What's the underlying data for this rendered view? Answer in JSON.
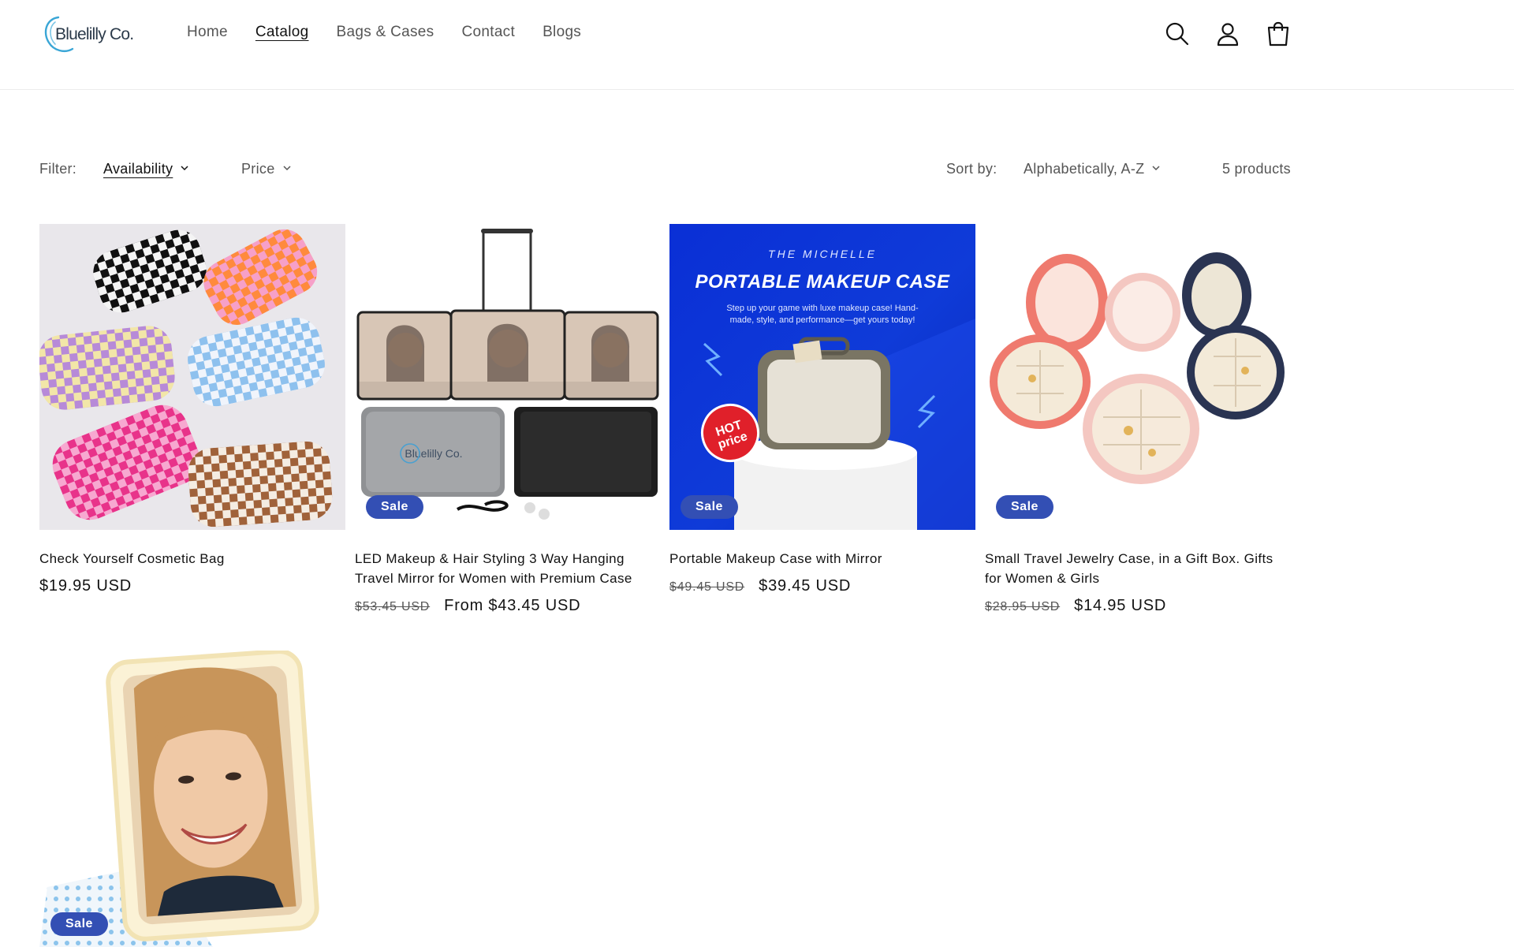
{
  "brand": {
    "name": "Bluelilly Co."
  },
  "nav": {
    "items": [
      {
        "label": "Home",
        "active": false
      },
      {
        "label": "Catalog",
        "active": true
      },
      {
        "label": "Bags & Cases",
        "active": false
      },
      {
        "label": "Contact",
        "active": false
      },
      {
        "label": "Blogs",
        "active": false
      }
    ]
  },
  "header_icons": [
    "search-icon",
    "account-icon",
    "cart-icon"
  ],
  "filters": {
    "label": "Filter:",
    "availability": "Availability",
    "price": "Price",
    "sort_label": "Sort by:",
    "sort_value": "Alphabetically, A-Z",
    "count": "5 products"
  },
  "products": [
    {
      "title": "Check Yourself Cosmetic Bag",
      "price": "$19.95 USD",
      "compare_at": "",
      "badge": ""
    },
    {
      "title": "LED Makeup & Hair Styling 3 Way Hanging Travel Mirror for Women with Premium Case",
      "price": "From $43.45 USD",
      "compare_at": "$53.45 USD",
      "badge": "Sale",
      "image_text": "Bluelilly Co."
    },
    {
      "title": "Portable Makeup Case with Mirror",
      "price": "$39.45 USD",
      "compare_at": "$49.45 USD",
      "badge": "Sale",
      "image_text": {
        "kicker": "THE MICHELLE",
        "headline": "PORTABLE MAKEUP CASE",
        "desc": "Step up your game with luxe makeup case! Hand-made, style, and performance—get yours today!",
        "sticker": "HOT price"
      }
    },
    {
      "title": "Small Travel Jewelry Case, in a Gift Box. Gifts for Women & Girls",
      "price": "$14.95 USD",
      "compare_at": "$28.95 USD",
      "badge": "Sale"
    },
    {
      "title": "",
      "price": "",
      "compare_at": "",
      "badge": "Sale"
    }
  ],
  "colors": {
    "badge": "#334fb4",
    "makeup_bg": "#0f3bd8"
  }
}
